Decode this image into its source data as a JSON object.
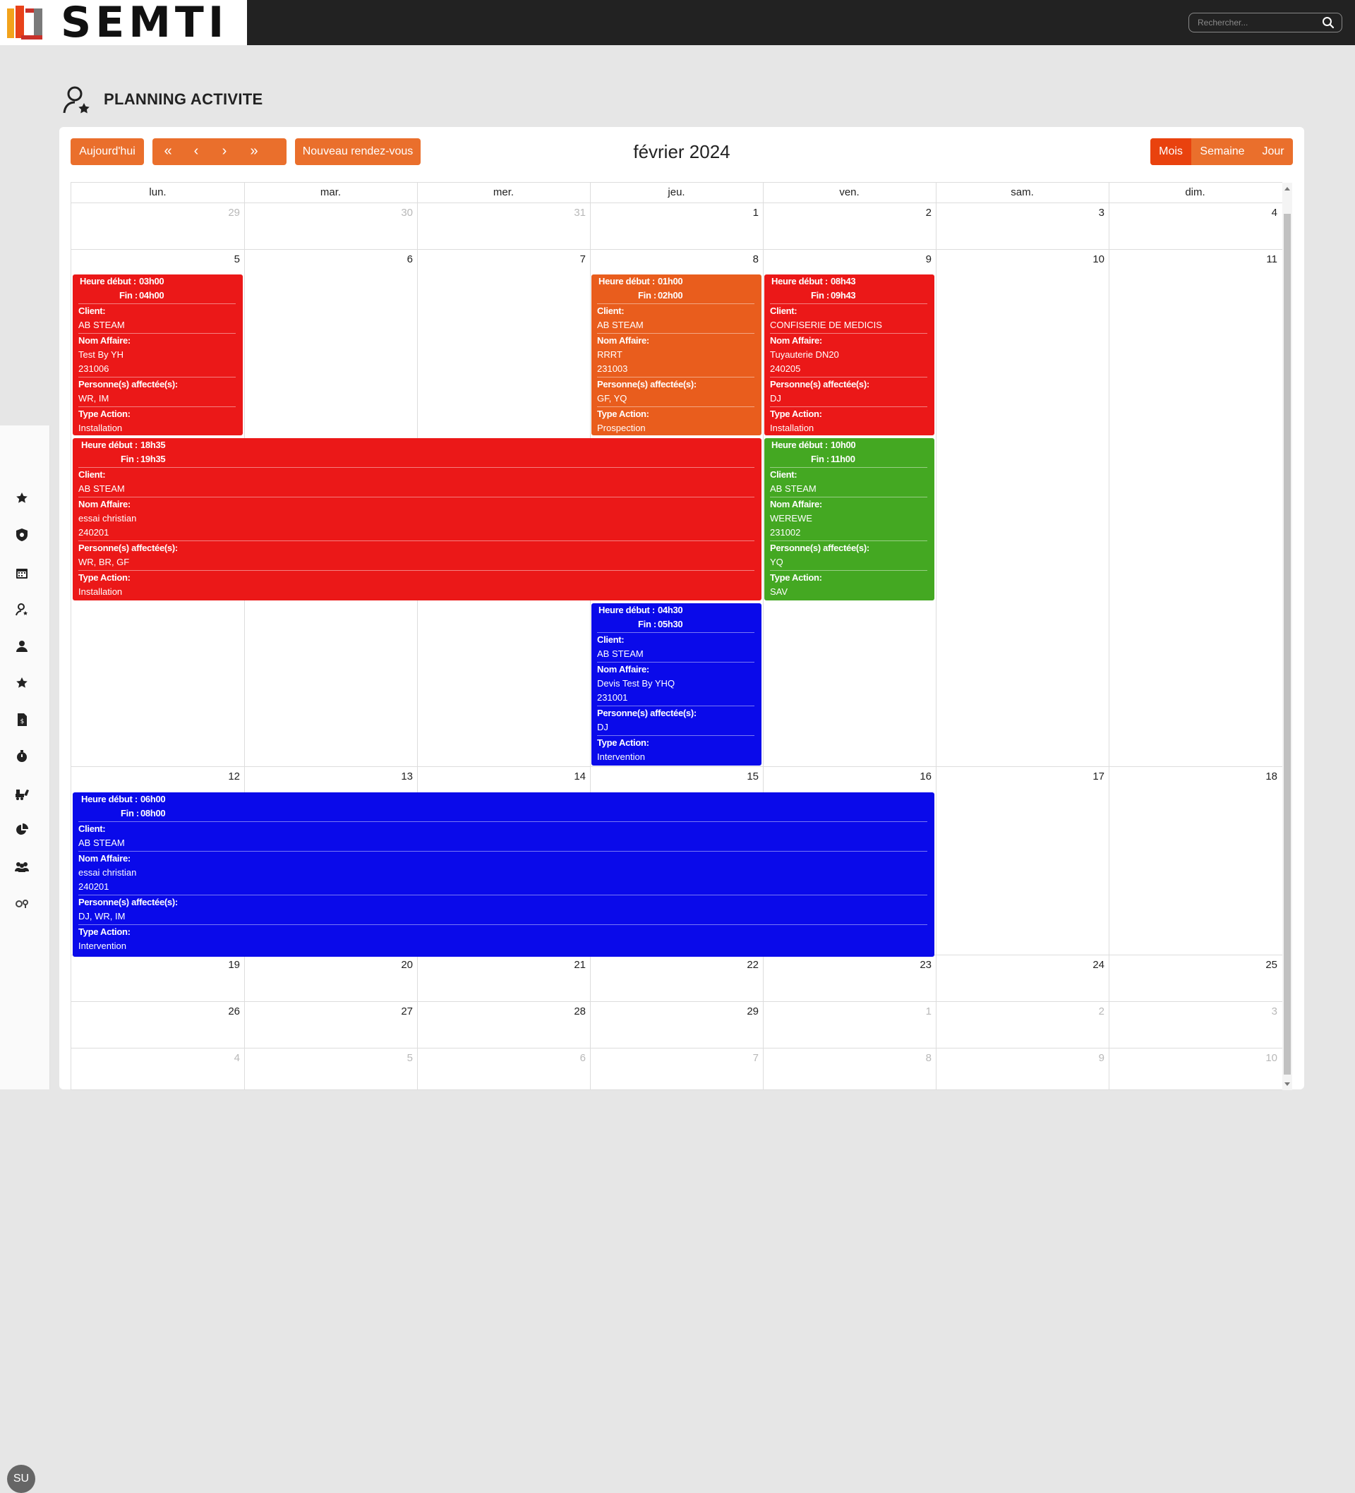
{
  "brand": {
    "name": "SEMTI"
  },
  "search": {
    "placeholder": "Rechercher..."
  },
  "sidebar": {
    "icons": [
      "star-icon",
      "shield-icon",
      "calendar-icon",
      "user-star-icon",
      "user-icon",
      "star-icon",
      "invoice-icon",
      "stopwatch-icon",
      "machine-icon",
      "pie-chart-icon",
      "users-icon",
      "settings-keys-icon"
    ],
    "avatar": "SU"
  },
  "page": {
    "title": "PLANNING ACTIVITE"
  },
  "toolbar": {
    "today": "Aujourd'hui",
    "first": "«",
    "prev": "‹",
    "next": "›",
    "last": "»",
    "new": "Nouveau rendez-vous",
    "month_title": "février 2024",
    "views": [
      "Mois",
      "Semaine",
      "Jour"
    ],
    "active_view": "Mois"
  },
  "calendar": {
    "days_of_week": [
      "lun.",
      "mar.",
      "mer.",
      "jeu.",
      "ven.",
      "sam.",
      "dim."
    ],
    "weeks": [
      [
        "29",
        "30",
        "31",
        "1",
        "2",
        "3",
        "4"
      ],
      [
        "5",
        "6",
        "7",
        "8",
        "9",
        "10",
        "11"
      ],
      [
        "12",
        "13",
        "14",
        "15",
        "16",
        "17",
        "18"
      ],
      [
        "19",
        "20",
        "21",
        "22",
        "23",
        "24",
        "25"
      ],
      [
        "26",
        "27",
        "28",
        "29",
        "1",
        "2",
        "3"
      ],
      [
        "4",
        "5",
        "6",
        "7",
        "8",
        "9",
        "10"
      ]
    ],
    "labels": {
      "start": "Heure début :",
      "end": "Fin :",
      "client": "Client:",
      "affaire": "Nom Affaire:",
      "persons": "Personne(s) affectée(s):",
      "type": "Type Action:"
    },
    "events": [
      {
        "start": "03h00",
        "end": "04h00",
        "client": "AB STEAM",
        "affaire": "Test By YH",
        "code": "231006",
        "persons": "WR, IM",
        "type": "Installation",
        "color": "#eb1818"
      },
      {
        "start": "01h00",
        "end": "02h00",
        "client": "AB STEAM",
        "affaire": "RRRT",
        "code": "231003",
        "persons": "GF, YQ",
        "type": "Prospection",
        "color": "#e95d1d"
      },
      {
        "start": "08h43",
        "end": "09h43",
        "client": "CONFISERIE DE MEDICIS",
        "affaire": "Tuyauterie DN20",
        "code": "240205",
        "persons": "DJ",
        "type": "Installation",
        "color": "#eb1818"
      },
      {
        "start": "18h35",
        "end": "19h35",
        "client": "AB STEAM",
        "affaire": "essai christian",
        "code": "240201",
        "persons": "WR, BR, GF",
        "type": "Installation",
        "color": "#eb1818"
      },
      {
        "start": "10h00",
        "end": "11h00",
        "client": "AB STEAM",
        "affaire": "WEREWE",
        "code": "231002",
        "persons": "YQ",
        "type": "SAV",
        "color": "#44a822"
      },
      {
        "start": "04h30",
        "end": "05h30",
        "client": "AB STEAM",
        "affaire": "Devis Test By YHQ",
        "code": "231001",
        "persons": "DJ",
        "type": "Intervention",
        "color": "#0a0aea"
      },
      {
        "start": "06h00",
        "end": "08h00",
        "client": "AB STEAM",
        "affaire": "essai christian",
        "code": "240201",
        "persons": "DJ, WR, IM",
        "type": "Intervention",
        "color": "#0a0aea"
      }
    ]
  }
}
